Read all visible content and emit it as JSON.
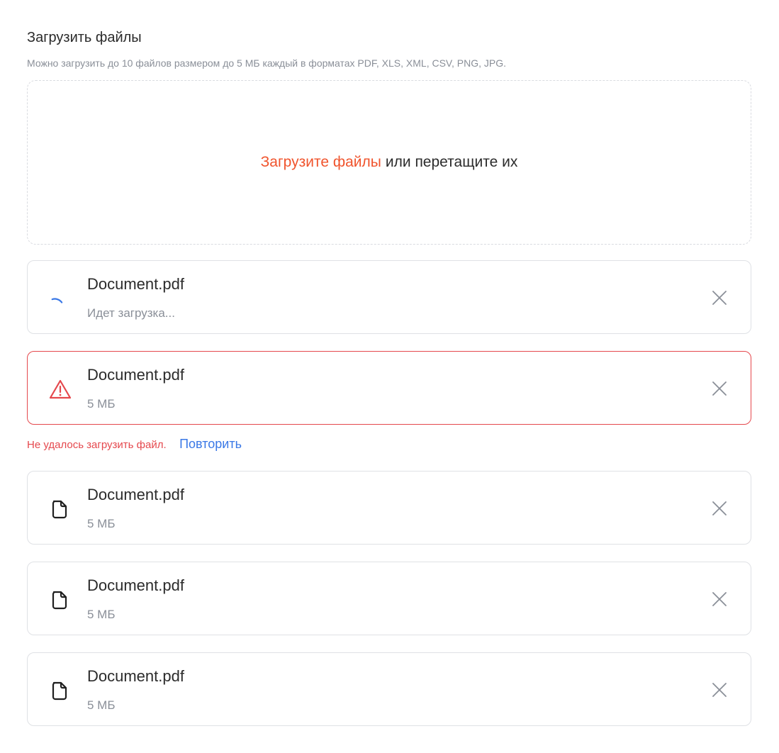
{
  "header": {
    "title": "Загрузить файлы",
    "subtitle": "Можно загрузить до 10 файлов размером до 5 МБ каждый в форматах PDF, XLS, XML, CSV, PNG, JPG."
  },
  "dropzone": {
    "link_label": "Загрузите файлы",
    "rest_label": "или перетащите их"
  },
  "files": [
    {
      "name": "Document.pdf",
      "meta": "Идет загрузка...",
      "state": "uploading",
      "icon": "spinner-icon"
    },
    {
      "name": "Document.pdf",
      "meta": "5 МБ",
      "state": "error",
      "icon": "warning-icon"
    },
    {
      "name": "Document.pdf",
      "meta": "5 МБ",
      "state": "done",
      "icon": "file-icon"
    },
    {
      "name": "Document.pdf",
      "meta": "5 МБ",
      "state": "done",
      "icon": "file-icon"
    },
    {
      "name": "Document.pdf",
      "meta": "5 МБ",
      "state": "done",
      "icon": "file-icon"
    }
  ],
  "error": {
    "message": "Не удалось загрузить файл.",
    "retry_label": "Повторить"
  },
  "colors": {
    "accent": "#f0542d",
    "error": "#e5484d",
    "link": "#3a78e6",
    "spinner": "#3a78e6"
  }
}
